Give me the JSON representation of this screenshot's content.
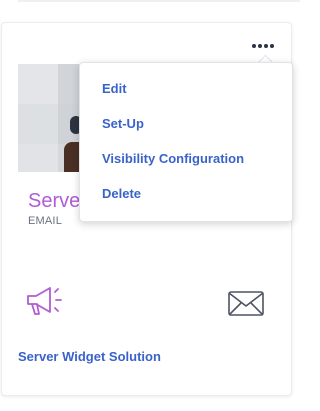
{
  "card": {
    "title": "Serve",
    "subtitle": "EMAIL",
    "link_label": "Server Widget Solution",
    "icons": {
      "more": "more-horizontal-icon",
      "announce": "megaphone-icon",
      "mail": "envelope-icon"
    }
  },
  "menu": {
    "items": [
      {
        "label": "Edit"
      },
      {
        "label": "Set-Up"
      },
      {
        "label": "Visibility Configuration"
      },
      {
        "label": "Delete"
      }
    ]
  },
  "colors": {
    "title": "#b05cd4",
    "link": "#3a63c9",
    "icon_megaphone": "#b05cd4",
    "icon_envelope": "#4b5563"
  }
}
